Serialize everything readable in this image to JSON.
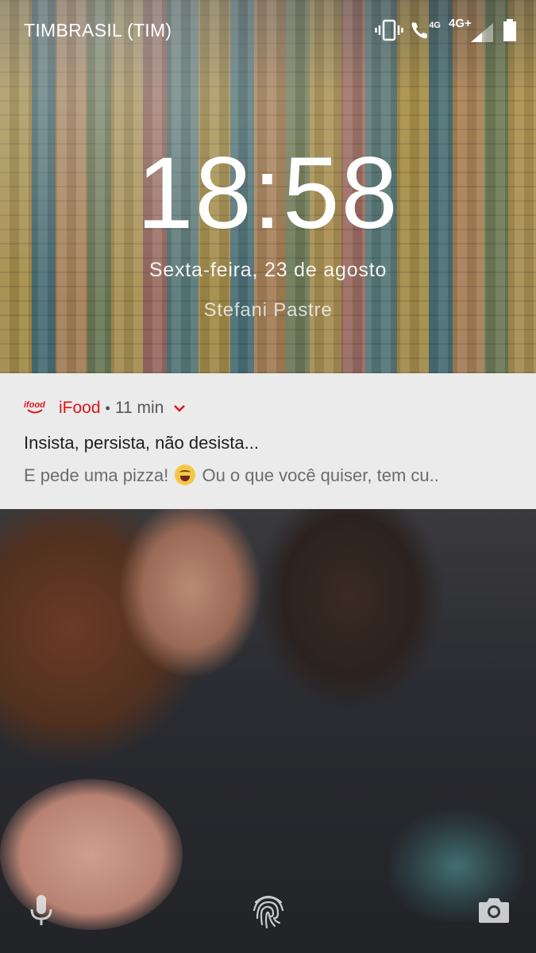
{
  "status_bar": {
    "carrier": "TIMBRASIL (TIM)",
    "call_network_label": "4G",
    "data_network_label": "4G+",
    "icons": [
      "vibrate-icon",
      "wifi-call-icon",
      "signal-icon",
      "battery-icon"
    ]
  },
  "lockscreen": {
    "time": "18:58",
    "date": "Sexta-feira, 23 de agosto",
    "owner_info": "Stefani Pastre"
  },
  "notification": {
    "app_logo_text": "ifood",
    "app_name": "iFood",
    "separator": "•",
    "time_ago": "11 min",
    "title": "Insista, persista, não desista...",
    "text_before_emoji": "E pede uma pizza! ",
    "emoji": "face-with-tears-of-joy",
    "text_after_emoji": " Ou o que você quiser, tem cu..",
    "accent_color": "#e0131d",
    "background_color": "#ebebeb"
  },
  "shortcuts": {
    "left": "mic-icon",
    "center": "fingerprint-icon",
    "right": "camera-icon"
  }
}
